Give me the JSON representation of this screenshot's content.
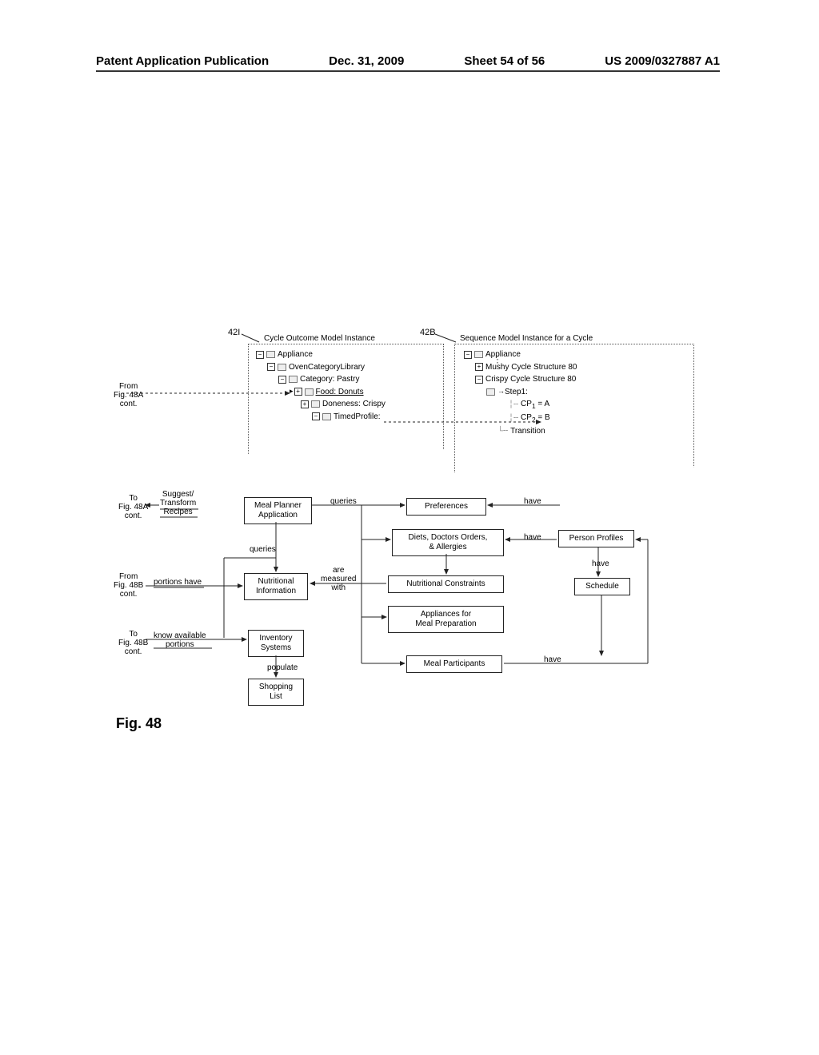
{
  "header": {
    "publication_label": "Patent Application Publication",
    "date": "Dec. 31, 2009",
    "sheet": "Sheet 54 of 56",
    "pubno": "US 2009/0327887 A1"
  },
  "figure_label": "Fig. 48",
  "refs": {
    "r42I": "42I",
    "r42B": "42B"
  },
  "crossrefs": {
    "from48a": "From\nFig. 48A\ncont.",
    "to48a": "To\nFig. 48A\ncont.",
    "from48b": "From\nFig. 48B\ncont.",
    "to48b": "To\nFig. 48B\ncont."
  },
  "tree_left": {
    "title": "Cycle Outcome Model Instance",
    "n0": "Appliance",
    "n1": "OvenCategoryLibrary",
    "n2": "Category: Pastry",
    "n3": "Food: Donuts",
    "n4": "Doneness: Crispy",
    "n5": "TimedProfile:"
  },
  "tree_right": {
    "title": "Sequence Model Instance for a Cycle",
    "n0": "Appliance",
    "n1": "Mushy Cycle Structure 80",
    "n2": "Crispy Cycle Structure 80",
    "n3": "Step1:",
    "n4a": "CP",
    "n4a_sub": "1",
    "n4a_rhs": " = A",
    "n4b": "CP",
    "n4b_sub": "2",
    "n4b_rhs": " = B",
    "n5": "Transition"
  },
  "labels": {
    "suggest_transform": "Suggest/\nTransform\nRecipes",
    "queries1": "queries",
    "queries2": "queries",
    "have1": "have",
    "have2": "have",
    "have3": "have",
    "have4": "have",
    "portions_have": "portions have",
    "know_available_portions": "know available\nportions",
    "are_measured_with": "are\nmeasured\nwith",
    "populate": "populate"
  },
  "boxes": {
    "meal_planner": "Meal Planner\nApplication",
    "preferences": "Preferences",
    "diets": "Diets, Doctors Orders,\n& Allergies",
    "person_profiles": "Person Profiles",
    "nutritional_info": "Nutritional\nInformation",
    "nutritional_constraints": "Nutritional Constraints",
    "schedule": "Schedule",
    "appliances_prep": "Appliances for\nMeal Preparation",
    "inventory": "Inventory\nSystems",
    "meal_participants": "Meal Participants",
    "shopping_list": "Shopping\nList"
  }
}
